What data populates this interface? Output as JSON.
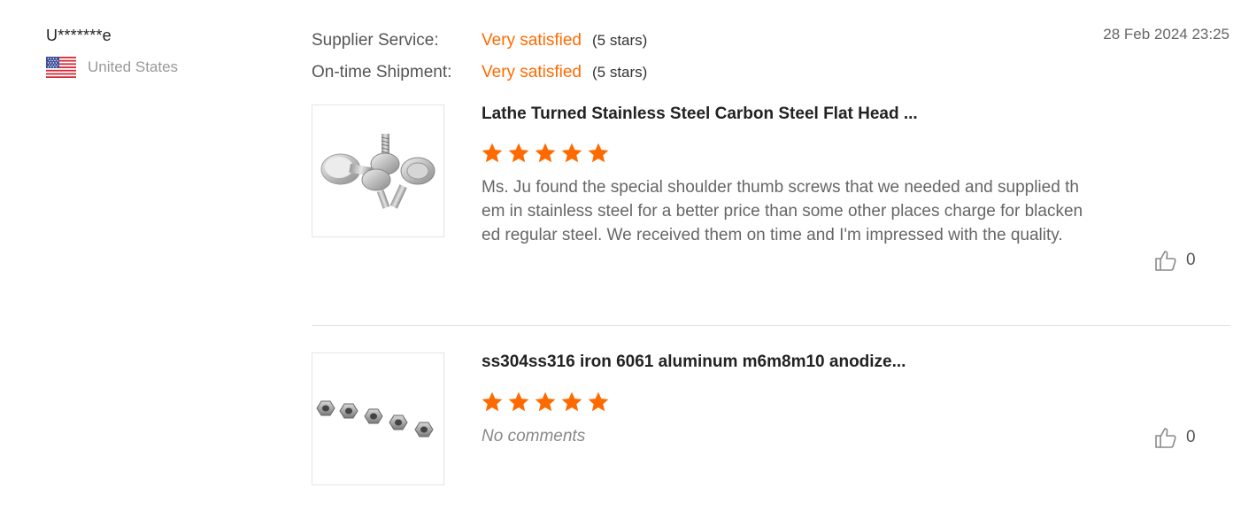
{
  "review": {
    "reviewer": {
      "name": "U*******e",
      "country": "United States",
      "flag_icon": "us-flag-icon"
    },
    "date": "28 Feb 2024 23:25",
    "ratings": [
      {
        "label": "Supplier Service:",
        "value": "Very satisfied",
        "stars": "(5 stars)"
      },
      {
        "label": "On-time Shipment:",
        "value": "Very satisfied",
        "stars": "(5 stars)"
      }
    ],
    "products": [
      {
        "title": "Lathe Turned Stainless Steel Carbon Steel Flat Head ...",
        "rating": 5,
        "comment": "Ms. Ju found the special shoulder thumb screws that we needed and supplied them in stainless steel for a better price than some other places charge for blackened regular steel.  We received them on time and I'm impressed with the quality.",
        "likes": "0",
        "image_icon": "thumb-screws-image"
      },
      {
        "title": "ss304ss316 iron 6061 aluminum m6m8m10 anodize...",
        "rating": 5,
        "comment": "No comments",
        "likes": "0",
        "image_icon": "hex-nuts-image"
      }
    ]
  },
  "colors": {
    "accent": "#ff6a00",
    "star": "#ff6a00",
    "divider": "#e3e3e3"
  }
}
